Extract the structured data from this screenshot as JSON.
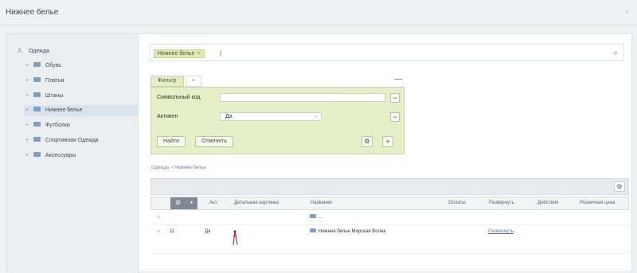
{
  "window": {
    "title": "Нижнее белье",
    "close_icon": "close-icon"
  },
  "sidebar": {
    "items": [
      {
        "label": "Одежда",
        "icon": "person-icon",
        "active": false
      },
      {
        "label": "Обувь",
        "icon": "folder-icon",
        "active": false
      },
      {
        "label": "Платья",
        "icon": "folder-icon",
        "active": false
      },
      {
        "label": "Штаны",
        "icon": "folder-icon",
        "active": false
      },
      {
        "label": "Нижнее белье",
        "icon": "folder-icon",
        "active": true
      },
      {
        "label": "Футболки",
        "icon": "folder-icon",
        "active": false
      },
      {
        "label": "Спортивная Одежда",
        "icon": "folder-icon",
        "active": false
      },
      {
        "label": "Аксессуары",
        "icon": "folder-icon",
        "active": false
      }
    ]
  },
  "search": {
    "tag": "Нижнее белье",
    "tag_close": "×",
    "cursor": "|",
    "icon": "search-icon"
  },
  "filter": {
    "tab": "Фильтр",
    "add_tab": "+",
    "rows": [
      {
        "label": "Символьный код",
        "value": ""
      },
      {
        "label": "Активен",
        "value": "Да"
      }
    ],
    "find_button": "Найти",
    "reset_button": "Отменить",
    "settings_icon": "⚙",
    "add_icon": "+"
  },
  "breadcrumb": {
    "parent": "Одежда",
    "separator": ">",
    "current": "Нижнее белье"
  },
  "table": {
    "columns": [
      "Акт.",
      "Детальная картинка",
      "Название",
      "Оплаты",
      "Развернуть",
      "Действия",
      "Розничная цена"
    ],
    "rows": [
      {
        "id": "",
        "active": "",
        "name": "..",
        "link": ""
      },
      {
        "id": "11",
        "active": "Да",
        "name": "Нижнее белье Морская Волна",
        "link": "Развернуть"
      }
    ]
  }
}
